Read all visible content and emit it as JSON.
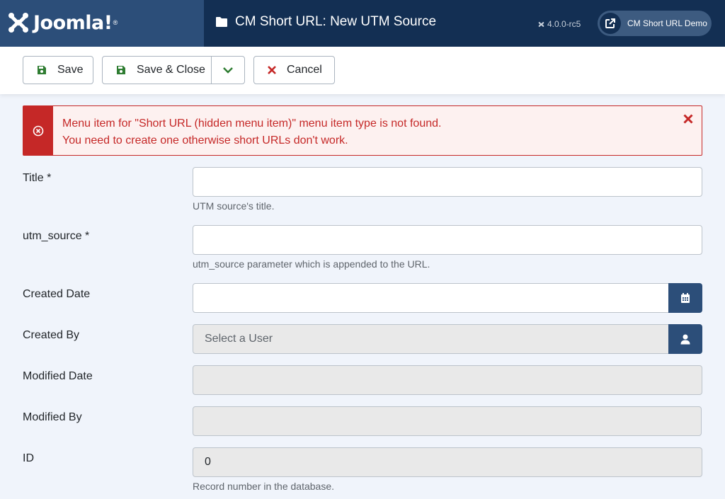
{
  "header": {
    "logo_text": "Joomla!",
    "title": "CM Short URL: New UTM Source",
    "version": "4.0.0-rc5",
    "site_link": "CM Short URL Demo"
  },
  "toolbar": {
    "save_label": "Save",
    "save_close_label": "Save & Close",
    "cancel_label": "Cancel"
  },
  "alert": {
    "line1": "Menu item for \"Short URL (hidden menu item)\" menu item type is not found.",
    "line2": "You need to create one otherwise short URLs don't work."
  },
  "form": {
    "title_label": "Title *",
    "title_value": "",
    "title_help": "UTM source's title.",
    "utm_label": "utm_source *",
    "utm_value": "",
    "utm_help": "utm_source parameter which is appended to the URL.",
    "created_date_label": "Created Date",
    "created_date_value": "",
    "created_by_label": "Created By",
    "created_by_value": "Select a User",
    "modified_date_label": "Modified Date",
    "modified_date_value": "",
    "modified_by_label": "Modified By",
    "modified_by_value": "",
    "id_label": "ID",
    "id_value": "0",
    "id_help": "Record number in the database."
  },
  "colors": {
    "header_bg": "#132f53",
    "logo_bg": "#2c4e79",
    "danger": "#c52827",
    "success_icon": "#2f7d32"
  }
}
